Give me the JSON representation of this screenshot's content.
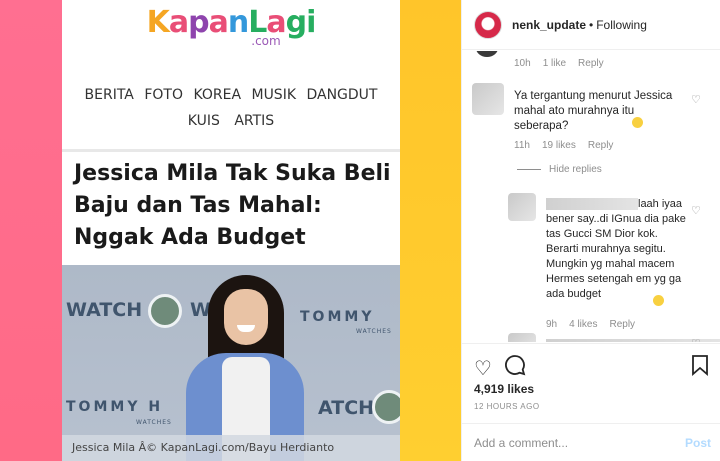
{
  "image": {
    "logo": {
      "text": "KapanLagi",
      "suffix": ".com"
    },
    "nav_row1": [
      "BERITA",
      "FOTO",
      "KOREA",
      "MUSIK",
      "DANGDUT"
    ],
    "nav_row2": [
      "KUIS",
      "ARTIS"
    ],
    "headline": "Jessica Mila Tak Suka Beli Baju dan Tas Mahal: Nggak Ada Budget",
    "brands": {
      "watch1": "WATCH",
      "watch2": "WO",
      "tommy1": "TOMMY",
      "tommy_sub1": "WATCHES",
      "tommy2": "TOMMY H",
      "tommy_sub2": "WATCHES",
      "watch3": "ATCH"
    },
    "caption": "Jessica Mila Â© KapanLagi.com/Bayu Herdianto"
  },
  "header": {
    "username": "nenk_update",
    "separator": "•",
    "following": "Following"
  },
  "comments": {
    "top_meta": {
      "time": "10h",
      "likes": "1 like",
      "reply": "Reply"
    },
    "comment1": {
      "text": "Ya tergantung menurut Jessica mahal ato murahnya itu seberapa?",
      "meta": {
        "time": "11h",
        "likes": "19 likes",
        "reply": "Reply"
      }
    },
    "hide_replies": "Hide replies",
    "reply1": {
      "text": "laah iyaa bener say..di IGnua dia pake tas Gucci SM Dior kok. Berarti murahnya segitu. Mungkin yg mahal macem Hermes setengah em yg ga ada budget",
      "meta": {
        "time": "9h",
        "likes": "4 likes",
        "reply": "Reply"
      }
    }
  },
  "actions": {
    "likes": "4,919 likes",
    "time_ago": "12 HOURS AGO"
  },
  "add_comment": {
    "placeholder": "Add a comment...",
    "post": "Post"
  }
}
